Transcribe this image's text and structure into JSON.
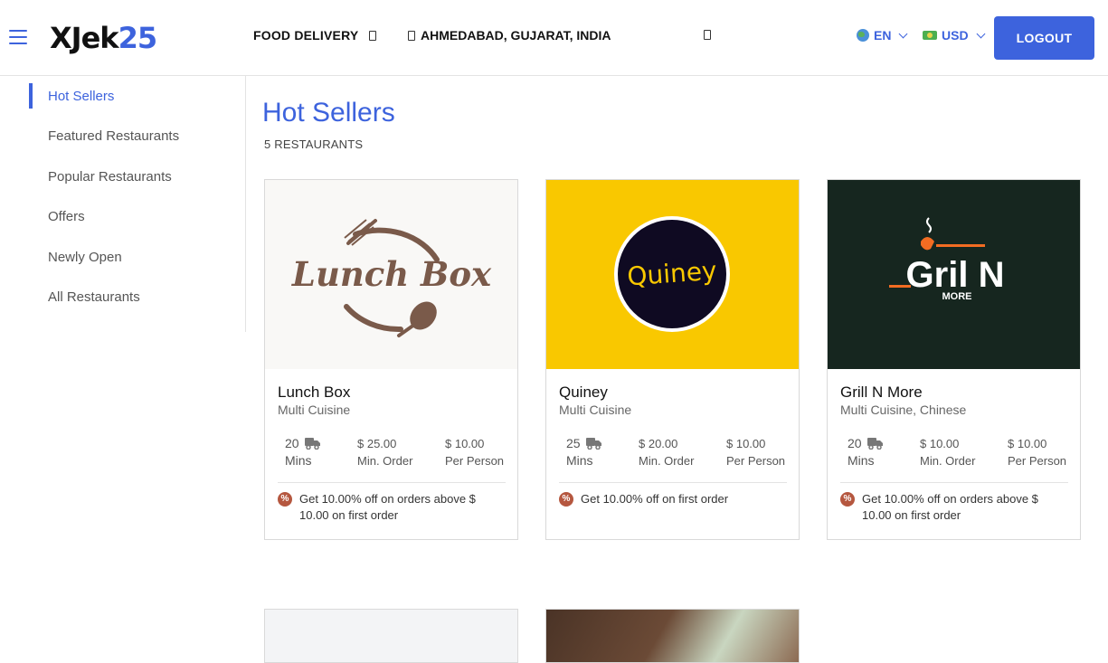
{
  "header": {
    "logo_main": "XJek",
    "logo_num": "25",
    "service": "FOOD DELIVERY",
    "location": "AHMEDABAD, GUJARAT, INDIA",
    "language": "EN",
    "currency": "USD",
    "logout": "LOGOUT"
  },
  "sidebar": {
    "items": [
      {
        "label": "Hot Sellers",
        "active": true
      },
      {
        "label": "Featured Restaurants"
      },
      {
        "label": "Popular Restaurants"
      },
      {
        "label": "Offers"
      },
      {
        "label": "Newly Open"
      },
      {
        "label": "All Restaurants"
      }
    ]
  },
  "main": {
    "title": "Hot Sellers",
    "count": "5 RESTAURANTS"
  },
  "restaurants": [
    {
      "name": "Lunch Box",
      "cuisine": "Multi Cuisine",
      "time": "20",
      "time_unit": "Mins",
      "min_order": "$ 25.00",
      "min_order_label": "Min. Order",
      "per_person": "$ 10.00",
      "per_person_label": "Per Person",
      "offer": "Get 10.00% off on orders above $ 10.00 on first order",
      "logo_text": "Lunch Box"
    },
    {
      "name": "Quiney",
      "cuisine": "Multi Cuisine",
      "time": "25",
      "time_unit": "Mins",
      "min_order": "$ 20.00",
      "min_order_label": "Min. Order",
      "per_person": "$ 10.00",
      "per_person_label": "Per Person",
      "offer": "Get 10.00% off on first order",
      "logo_text": "Quiney"
    },
    {
      "name": "Grill N More",
      "cuisine": "Multi Cuisine, Chinese",
      "time": "20",
      "time_unit": "Mins",
      "min_order": "$ 10.00",
      "min_order_label": "Min. Order",
      "per_person": "$ 10.00",
      "per_person_label": "Per Person",
      "offer": "Get 10.00% off on orders above $ 10.00 on first order",
      "logo_text": "Gril N",
      "logo_sub": "MORE"
    }
  ],
  "colors": {
    "accent": "#3d63dd",
    "quiney_bg": "#f9c800",
    "grill_bg": "#16261f",
    "grill_orange": "#f26c22",
    "lunchbox_brown": "#7a5a4a"
  }
}
